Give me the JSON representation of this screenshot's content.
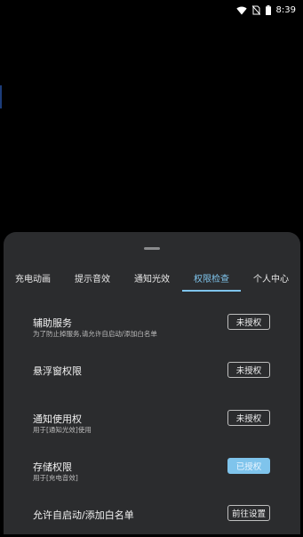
{
  "status_bar": {
    "time": "8:39",
    "icons": [
      "wifi-icon",
      "no-sim-icon",
      "battery-icon"
    ]
  },
  "tabs": [
    {
      "label": "充电动画"
    },
    {
      "label": "提示音效"
    },
    {
      "label": "通知光效"
    },
    {
      "label": "权限检查",
      "active": true
    },
    {
      "label": "个人中心"
    }
  ],
  "permissions": {
    "accessibility": {
      "title": "辅助服务",
      "subtitle": "为了防止掉服务,请允许自启动/添加白名单",
      "button": "未授权"
    },
    "overlay": {
      "title": "悬浮窗权限",
      "button": "未授权"
    },
    "notification": {
      "title": "通知使用权",
      "subtitle": "用于[通知光效]使用",
      "button": "未授权"
    },
    "storage": {
      "title": "存储权限",
      "subtitle": "用于[充电音效]",
      "button": "已授权"
    },
    "autostart": {
      "title": "允许自启动/添加白名单",
      "button": "前往设置"
    }
  },
  "colors": {
    "accent": "#7fc4ec",
    "sheet_background": "#2b2c2e",
    "screen_background": "#000000"
  }
}
